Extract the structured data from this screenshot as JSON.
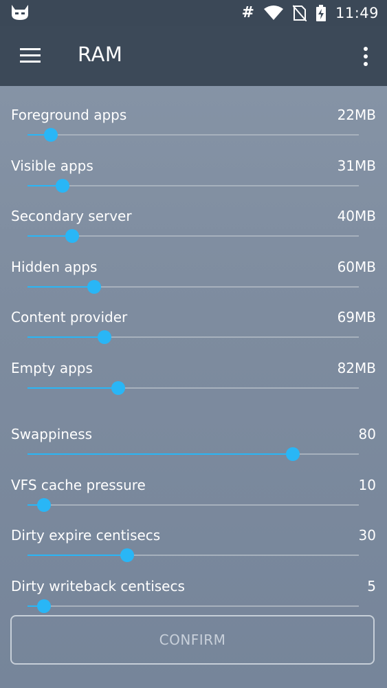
{
  "status_bar": {
    "time": "11:49",
    "icons": [
      "cyanogenmod-icon",
      "hash-icon",
      "wifi-icon",
      "no-sim-icon",
      "battery-charging-icon"
    ],
    "hash_glyph": "#"
  },
  "app_bar": {
    "title": "RAM",
    "menu_icon": "hamburger-menu-icon",
    "overflow_icon": "more-vert-icon"
  },
  "accent_color": "#29b6f6",
  "settings": [
    {
      "label": "Foreground apps",
      "value": "22MB",
      "fraction": 0.07
    },
    {
      "label": "Visible apps",
      "value": "31MB",
      "fraction": 0.105
    },
    {
      "label": "Secondary server",
      "value": "40MB",
      "fraction": 0.135
    },
    {
      "label": "Hidden apps",
      "value": "60MB",
      "fraction": 0.202
    },
    {
      "label": "Content provider",
      "value": "69MB",
      "fraction": 0.232
    },
    {
      "label": "Empty apps",
      "value": "82MB",
      "fraction": 0.273
    },
    {
      "label": "Swappiness",
      "value": "80",
      "fraction": 0.8
    },
    {
      "label": "VFS cache pressure",
      "value": "10",
      "fraction": 0.05
    },
    {
      "label": "Dirty expire centisecs",
      "value": "30",
      "fraction": 0.3
    },
    {
      "label": "Dirty writeback centisecs",
      "value": "5",
      "fraction": 0.05
    }
  ],
  "confirm_button": {
    "label": "CONFIRM"
  }
}
